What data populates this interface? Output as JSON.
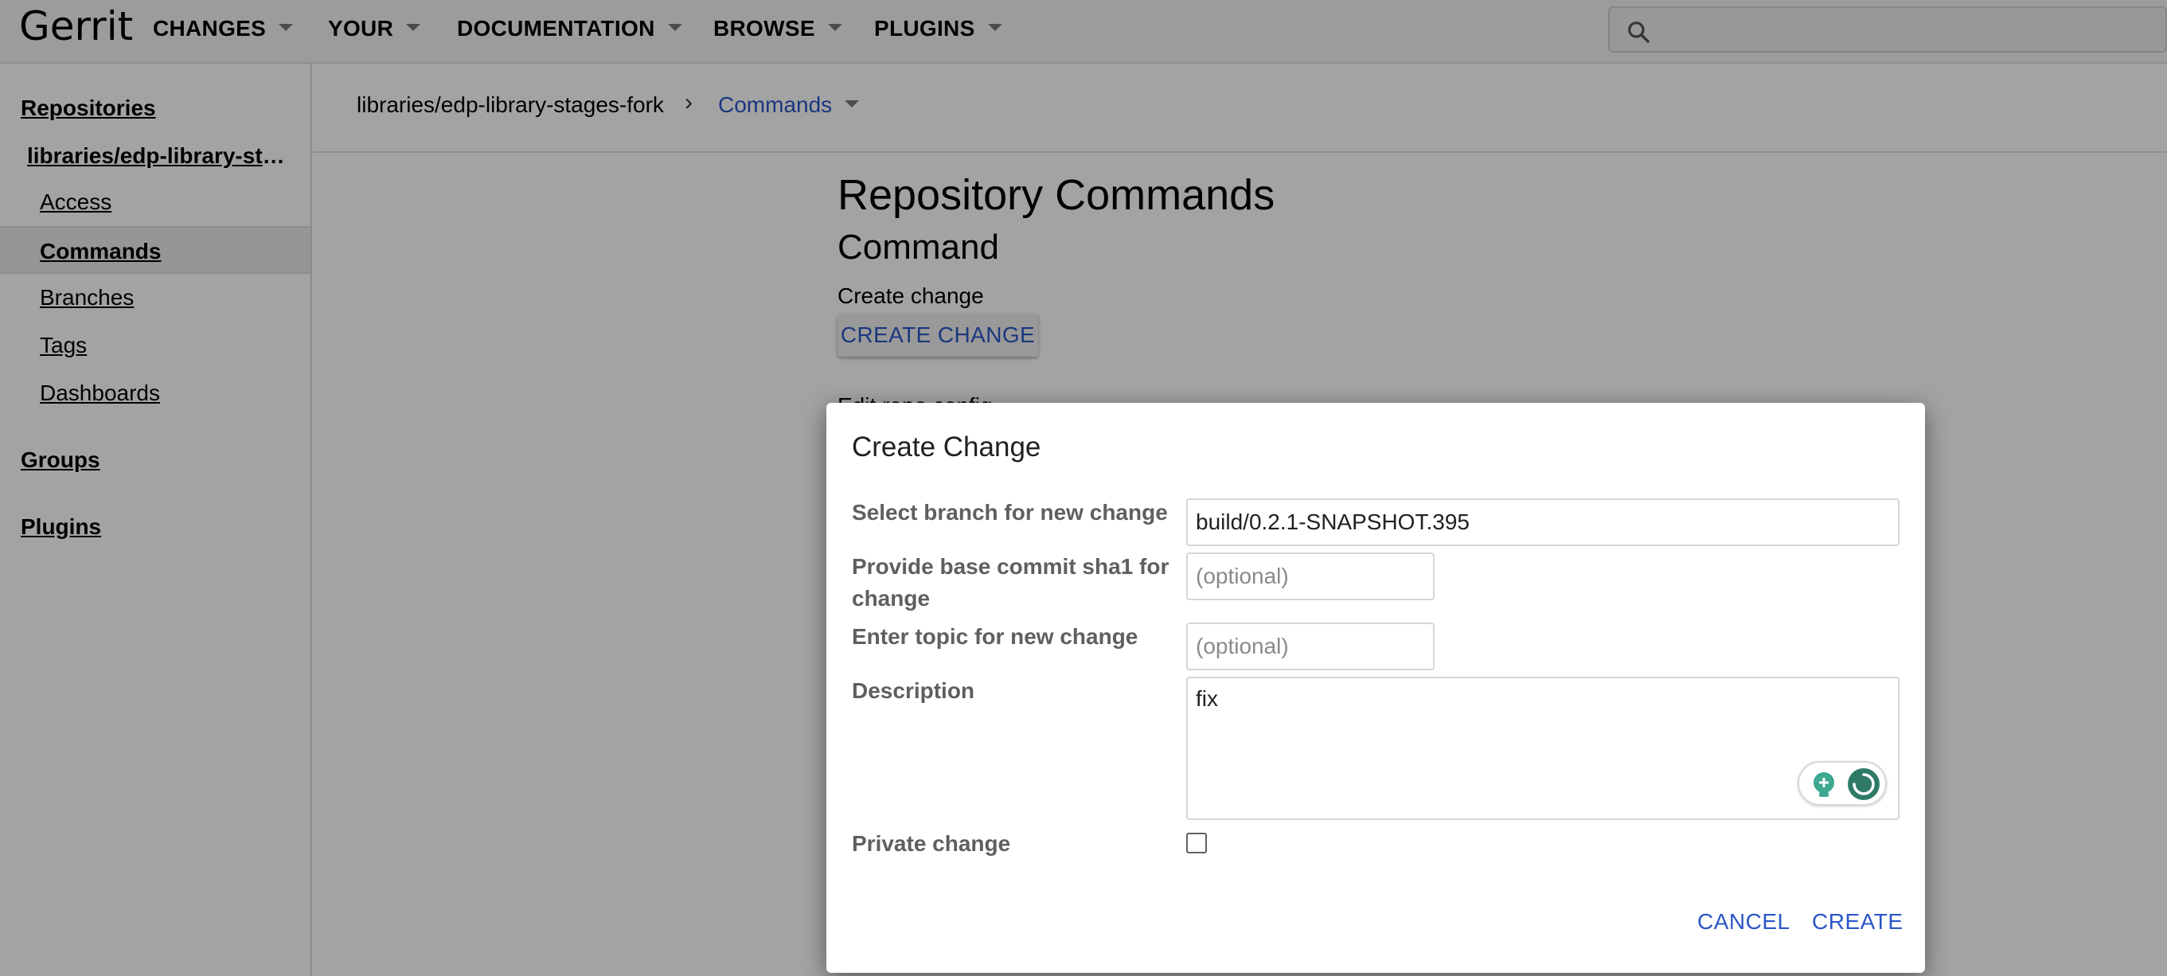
{
  "header": {
    "logo": "Gerrit",
    "nav": [
      "CHANGES",
      "YOUR",
      "DOCUMENTATION",
      "BROWSE",
      "PLUGINS"
    ],
    "search": {
      "value": "",
      "placeholder": ""
    }
  },
  "sidebar": {
    "repositories": "Repositories",
    "repo_name": "libraries/edp-library-sta…",
    "items": [
      "Access",
      "Commands",
      "Branches",
      "Tags",
      "Dashboards"
    ],
    "active_item": "Commands",
    "groups": "Groups",
    "plugins": "Plugins"
  },
  "breadcrumb": {
    "repo": "libraries/edp-library-stages-fork",
    "separator": "›",
    "current": "Commands"
  },
  "main": {
    "title": "Repository Commands",
    "section": "Command",
    "create_label": "Create change",
    "create_button": "CREATE CHANGE",
    "partial_next_label": "Edit repo config"
  },
  "dialog": {
    "title": "Create Change",
    "branch_label": "Select branch for new change",
    "branch_value": "build/0.2.1-SNAPSHOT.395",
    "base_label_line1": "Provide base commit sha1 for",
    "base_label_line2": "change",
    "base_placeholder": "(optional)",
    "topic_label": "Enter topic for new change",
    "topic_placeholder": "(optional)",
    "description_label": "Description",
    "description_value": "fix",
    "private_label": "Private change",
    "private_checked": false,
    "cancel_label": "CANCEL",
    "create_label": "CREATE"
  },
  "colors": {
    "link_blue": "#2a56c6",
    "label_gray": "#5f5f5f",
    "widget_green": "#3e8e7e"
  }
}
